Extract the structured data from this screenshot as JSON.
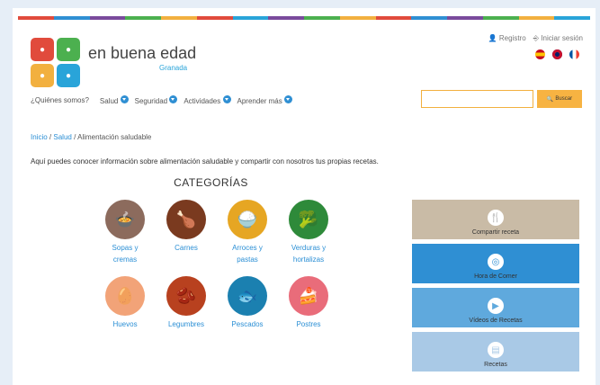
{
  "header": {
    "brand_name": "en buena edad",
    "brand_sub": "Granada",
    "register": "Registro",
    "login": "Iniciar sesión",
    "stripe_colors": [
      "#e14b3c",
      "#2f8fd3",
      "#7a4b9c",
      "#4cb04f",
      "#f2b03f",
      "#e14b3c",
      "#29a4d9",
      "#7a4b9c",
      "#4cb04f",
      "#f2b03f",
      "#e14b3c",
      "#2f8fd3",
      "#7a4b9c",
      "#4cb04f",
      "#f2b03f",
      "#29a4d9"
    ]
  },
  "nav": {
    "question": "¿Quiénes somos?",
    "items": [
      "Salud",
      "Seguridad",
      "Actividades",
      "Aprender más"
    ]
  },
  "search": {
    "placeholder": "",
    "button": "Buscar"
  },
  "breadcrumb": {
    "home": "Inicio",
    "sep": "/",
    "section": "Salud",
    "current": "Alimentación saludable"
  },
  "intro": "Aquí puedes conocer información sobre alimentación saludable y compartir con nosotros tus propias recetas.",
  "categories_title": "CATEGORÍAS",
  "categories": [
    {
      "label_1": "Sopas y",
      "label_2": "cremas",
      "color": "#8c6b5d",
      "icon": "bowl-icon"
    },
    {
      "label_1": "Carnes",
      "label_2": "",
      "color": "#7a3a1f",
      "icon": "meat-icon"
    },
    {
      "label_1": "Arroces y",
      "label_2": "pastas",
      "color": "#e6a623",
      "icon": "rice-icon"
    },
    {
      "label_1": "Verduras y",
      "label_2": "hortalizas",
      "color": "#2e8a3a",
      "icon": "vegetables-icon"
    },
    {
      "label_1": "Huevos",
      "label_2": "",
      "color": "#f2a378",
      "icon": "egg-icon"
    },
    {
      "label_1": "Legumbres",
      "label_2": "",
      "color": "#b8411f",
      "icon": "legumes-icon"
    },
    {
      "label_1": "Pescados",
      "label_2": "",
      "color": "#1b80b0",
      "icon": "fish-icon"
    },
    {
      "label_1": "Postres",
      "label_2": "",
      "color": "#e96c7a",
      "icon": "cake-icon"
    }
  ],
  "panels": [
    {
      "label": "Compartir receta",
      "color": "#c9bba6",
      "icon": "utensils-icon"
    },
    {
      "label": "Hora de Comer",
      "color": "#2f8fd3",
      "icon": "plate-icon"
    },
    {
      "label": "Vídeos de Recetas",
      "color": "#5fa9dd",
      "icon": "video-icon"
    },
    {
      "label": "Recetas",
      "color": "#a9c9e6",
      "icon": "book-icon"
    }
  ]
}
